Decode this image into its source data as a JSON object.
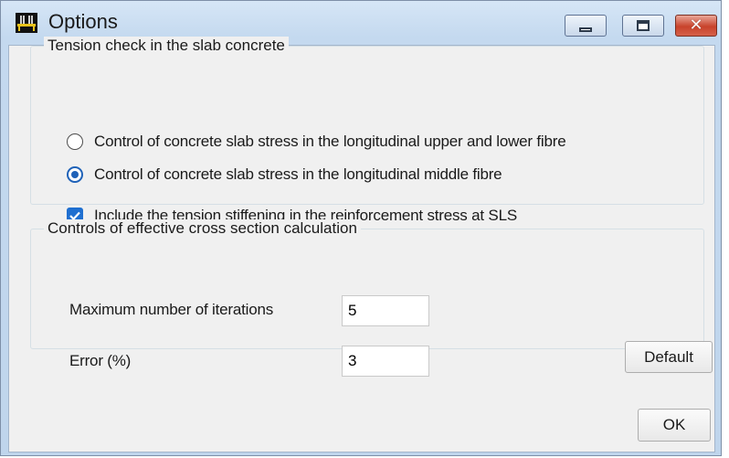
{
  "window": {
    "title": "Options",
    "icon": "app-logo-icon"
  },
  "caption_buttons": {
    "minimize": "minimize-icon",
    "maximize": "maximize-icon",
    "close": "close-icon"
  },
  "tension_group": {
    "title": "Tension check in the slab concrete",
    "options": [
      {
        "label": "Control of concrete slab stress in the longitudinal upper and lower fibre",
        "type": "radio",
        "checked": false
      },
      {
        "label": "Control of concrete slab stress in the longitudinal middle fibre",
        "type": "radio",
        "checked": true
      },
      {
        "label": "Include the tension stiffening in  the  reinforcement stress at SLS",
        "type": "checkbox",
        "checked": true
      }
    ]
  },
  "controls_group": {
    "title": "Controls of effective cross section calculation",
    "max_iterations": {
      "label": "Maximum number of iterations",
      "value": "5"
    },
    "error": {
      "label": "Error (%)",
      "value": "3"
    },
    "default_button": "Default"
  },
  "ok_button": "OK",
  "colors": {
    "accent": "#1f62b8",
    "frame": "#c4d9ef",
    "close": "#c8432c"
  }
}
